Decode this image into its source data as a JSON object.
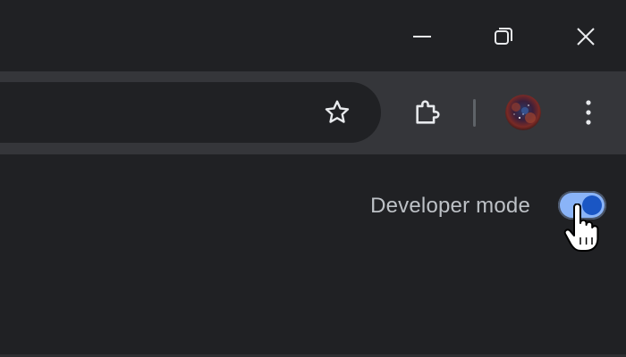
{
  "window_controls": {
    "minimize_icon": "minimize-icon",
    "restore_icon": "restore-icon",
    "close_icon": "close-icon"
  },
  "toolbar": {
    "bookmark_icon": "star-icon",
    "extensions_icon": "puzzle-icon",
    "profile_icon": "avatar",
    "menu_icon": "kebab-menu-icon"
  },
  "extensions_page": {
    "developer_mode_label": "Developer mode",
    "developer_mode_enabled": true
  },
  "colors": {
    "background": "#202124",
    "toolbar": "#35363a",
    "toggle_track": "#8ab4f8",
    "toggle_knob": "#1a56c4",
    "label_text": "#bdc1c6"
  }
}
